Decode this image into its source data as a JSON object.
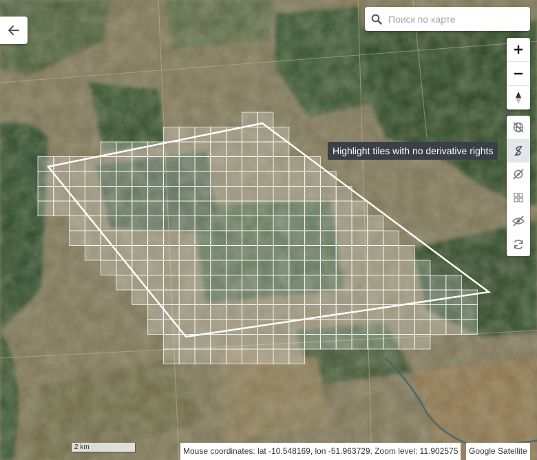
{
  "search": {
    "placeholder": "Поиск по карте"
  },
  "zoom_controls": {
    "zoom_in_icon": "plus-icon",
    "zoom_out_icon": "minus-icon",
    "north_icon": "compass-north-icon"
  },
  "tools": [
    {
      "icon": "globe-off-icon"
    },
    {
      "icon": "no-derivative-icon",
      "active": true
    },
    {
      "icon": "location-off-icon"
    },
    {
      "icon": "grid-icon"
    },
    {
      "icon": "eye-off-icon"
    },
    {
      "icon": "refresh-icon"
    }
  ],
  "tooltip": "Highlight tiles with no derivative rights",
  "scale_label": "2 km",
  "status": {
    "coordinates": "Mouse coordinates: lat -10.548169, lon -51.963729, Zoom level: 11.902575"
  },
  "attribution": "Google Satellite",
  "colors": {
    "forest": "#2e4a2a",
    "pasture": "#8a7e5f",
    "tile_fill": "#ffffff",
    "tooltip_bg": "#3b3f48"
  }
}
